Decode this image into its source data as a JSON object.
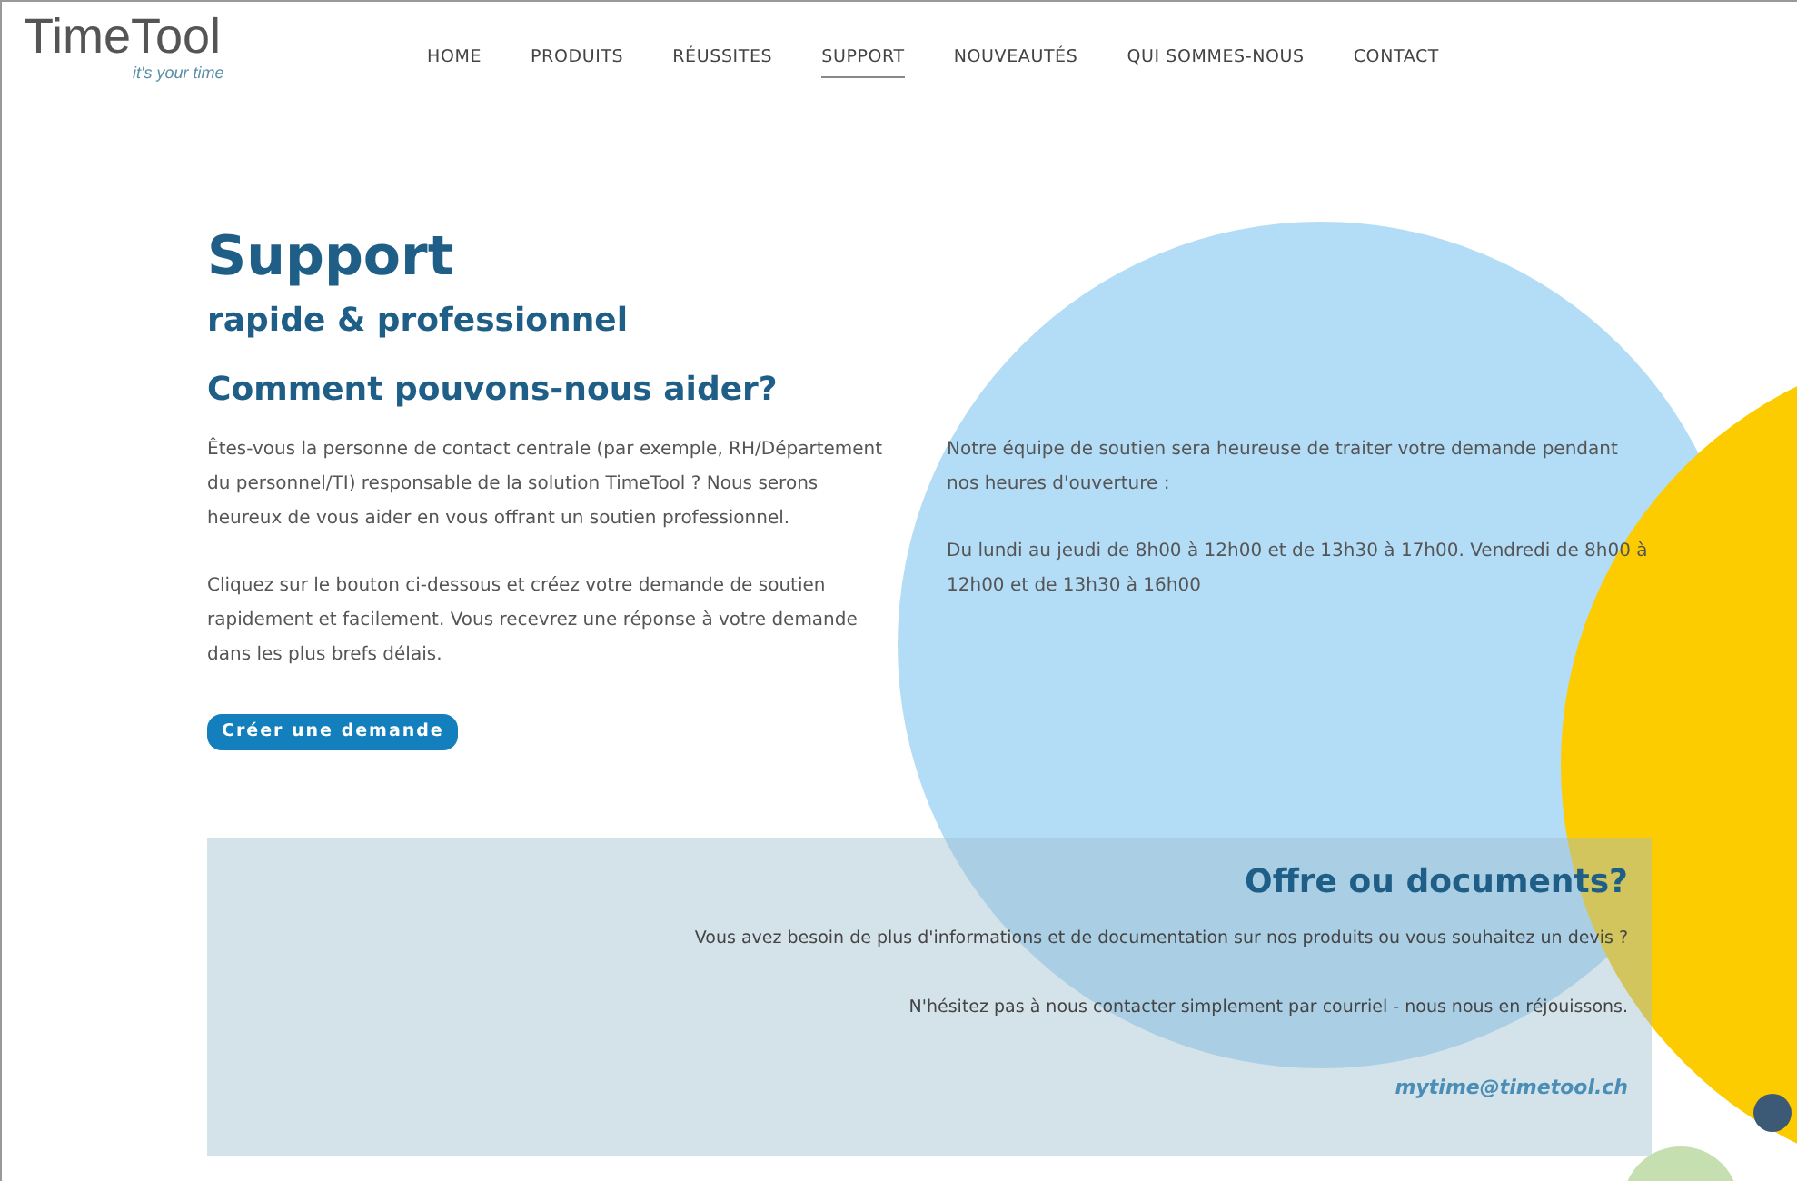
{
  "logo": {
    "name": "TimeTool",
    "tagline": "it's your time"
  },
  "nav": [
    {
      "label": "HOME",
      "selected": false
    },
    {
      "label": "PRODUITS",
      "selected": false
    },
    {
      "label": "RÉUSSITES",
      "selected": false
    },
    {
      "label": "SUPPORT",
      "selected": true
    },
    {
      "label": "NOUVEAUTÉS",
      "selected": false
    },
    {
      "label": "QUI SOMMES-NOUS",
      "selected": false
    },
    {
      "label": "CONTACT",
      "selected": false
    }
  ],
  "hero": {
    "title": "Support",
    "subtitle": "rapide & professionnel",
    "heading": "Comment pouvons-nous aider?",
    "left_paragraphs": [
      "Êtes-vous la personne de contact centrale (par exemple, RH/Département du personnel/TI) responsable de la solution TimeTool ? Nous serons heureux de vous aider en vous offrant un soutien professionnel.",
      "Cliquez sur le bouton ci-dessous et créez votre demande de soutien rapidement et facilement. Vous recevrez une réponse à votre demande dans les plus brefs délais."
    ],
    "button": "Créer une demande",
    "right_paragraphs": [
      "Notre équipe de soutien sera heureuse de traiter votre demande pendant nos heures d'ouverture :",
      "Du lundi au jeudi de 8h00 à 12h00 et de 13h30 à 17h00. Vendredi de 8h00 à 12h00 et de 13h30 à 16h00"
    ]
  },
  "offer": {
    "heading": "Offre ou documents?",
    "paragraphs": [
      "Vous avez besoin de plus d'informations et de documentation sur nos produits ou vous souhaitez un devis ?",
      "N'hésitez pas à nous contacter simplement par courriel - nous nous en réjouissons."
    ],
    "email": "mytime@timetool.ch"
  }
}
